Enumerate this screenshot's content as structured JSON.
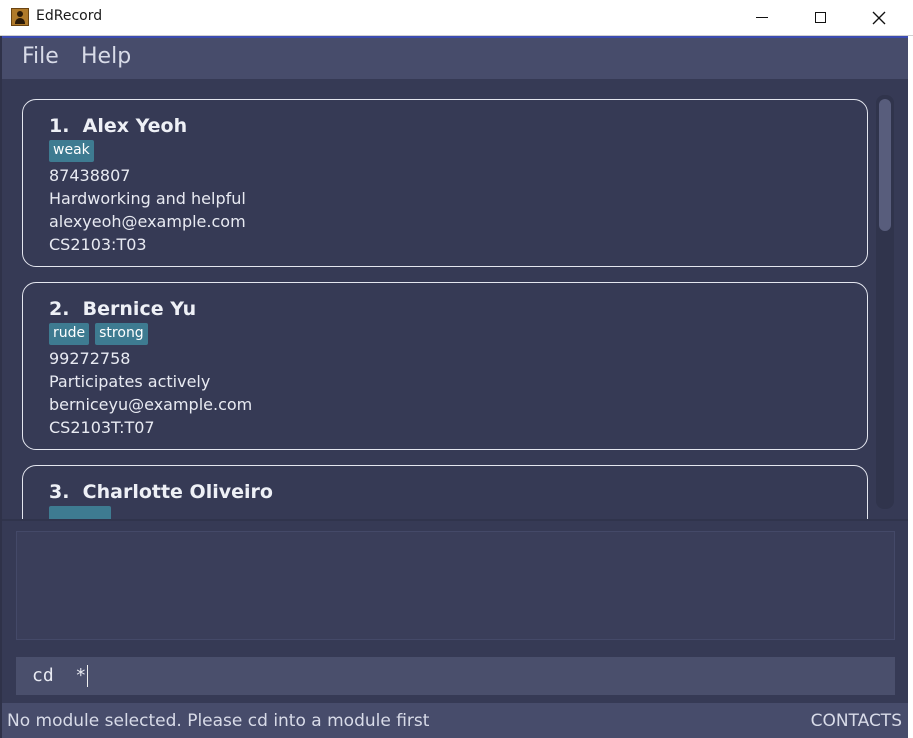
{
  "window": {
    "title": "EdRecord",
    "icon": "contact-book-icon"
  },
  "menu": {
    "file": "File",
    "help": "Help"
  },
  "persons": [
    {
      "title": "1.  Alex Yeoh",
      "tags": [
        "weak"
      ],
      "phone": "87438807",
      "info": "Hardworking and helpful",
      "email": "alexyeoh@example.com",
      "module": "CS2103:T03"
    },
    {
      "title": "2.  Bernice Yu",
      "tags": [
        "rude",
        "strong"
      ],
      "phone": "99272758",
      "info": "Participates actively",
      "email": "berniceyu@example.com",
      "module": "CS2103T:T07"
    },
    {
      "title": "3.  Charlotte Oliveiro",
      "tags": [
        ""
      ]
    }
  ],
  "result": {
    "text": ""
  },
  "command": {
    "value": "cd  *"
  },
  "status": {
    "message": "No module selected. Please cd into a module first",
    "view": "CONTACTS"
  },
  "colors": {
    "background": "#363a55",
    "menubar": "#474c6b",
    "tag": "#3e7b91",
    "card_border": "#e4e6ef"
  }
}
